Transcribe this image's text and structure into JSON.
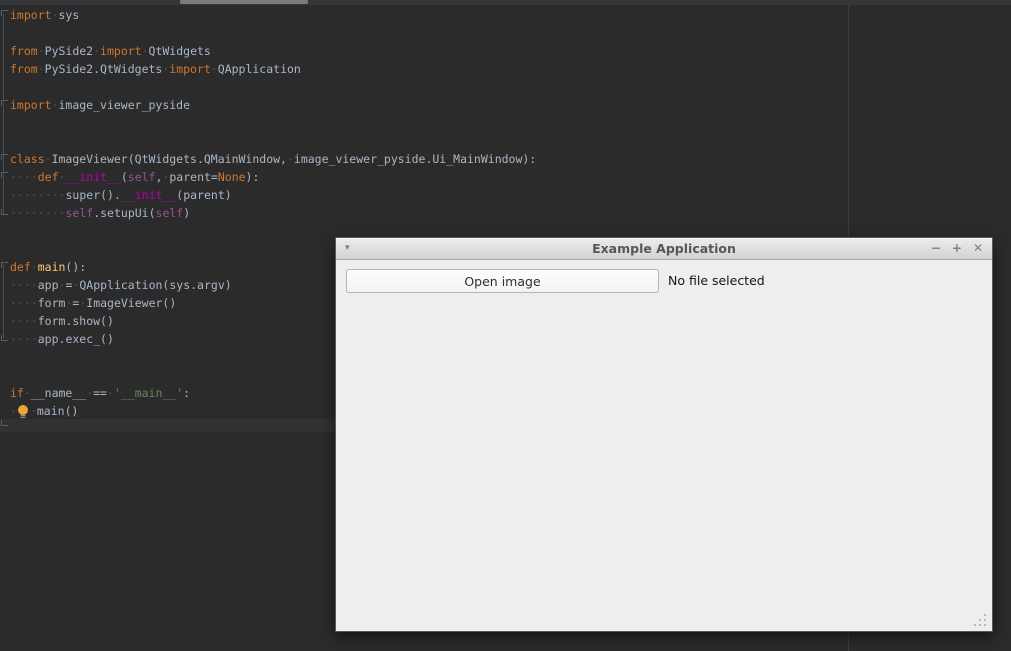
{
  "editor": {
    "background": "#2B2B2B",
    "syntax_colors": {
      "kw": "#CC7832",
      "pl": "#A9B7C6",
      "st": "#6A8759",
      "mg": "#B200B2",
      "sf": "#94558D",
      "fn": "#FFC66D"
    },
    "lines": [
      {
        "segments": [
          {
            "t": "import",
            "c": "kw"
          },
          {
            "t": " sys",
            "c": "pl"
          }
        ]
      },
      {
        "segments": []
      },
      {
        "segments": [
          {
            "t": "from",
            "c": "kw"
          },
          {
            "t": " PySide2 ",
            "c": "pl"
          },
          {
            "t": "import",
            "c": "kw"
          },
          {
            "t": " QtWidgets",
            "c": "pl"
          }
        ]
      },
      {
        "segments": [
          {
            "t": "from",
            "c": "kw"
          },
          {
            "t": " PySide2.QtWidgets ",
            "c": "pl"
          },
          {
            "t": "import",
            "c": "kw"
          },
          {
            "t": " QApplication",
            "c": "pl"
          }
        ]
      },
      {
        "segments": []
      },
      {
        "segments": [
          {
            "t": "import",
            "c": "kw"
          },
          {
            "t": " image_viewer_pyside",
            "c": "pl"
          }
        ]
      },
      {
        "segments": []
      },
      {
        "segments": []
      },
      {
        "segments": [
          {
            "t": "class",
            "c": "kw"
          },
          {
            "t": " ImageViewer(QtWidgets.QMainWindow, image_viewer_pyside.Ui_MainWindow):",
            "c": "pl"
          }
        ]
      },
      {
        "segments": [
          {
            "t": "    ",
            "c": "pl"
          },
          {
            "t": "def",
            "c": "kw"
          },
          {
            "t": " ",
            "c": "pl"
          },
          {
            "t": "__init__",
            "c": "mg"
          },
          {
            "t": "(",
            "c": "pl"
          },
          {
            "t": "self",
            "c": "sf"
          },
          {
            "t": ", parent=",
            "c": "pl"
          },
          {
            "t": "None",
            "c": "kw"
          },
          {
            "t": "):",
            "c": "pl"
          }
        ]
      },
      {
        "segments": [
          {
            "t": "        super().",
            "c": "pl"
          },
          {
            "t": "__init__",
            "c": "mg"
          },
          {
            "t": "(parent)",
            "c": "pl"
          }
        ]
      },
      {
        "segments": [
          {
            "t": "        ",
            "c": "pl"
          },
          {
            "t": "self",
            "c": "sf"
          },
          {
            "t": ".setupUi(",
            "c": "pl"
          },
          {
            "t": "self",
            "c": "sf"
          },
          {
            "t": ")",
            "c": "pl"
          }
        ]
      },
      {
        "segments": []
      },
      {
        "segments": []
      },
      {
        "segments": [
          {
            "t": "def",
            "c": "kw"
          },
          {
            "t": " ",
            "c": "pl"
          },
          {
            "t": "main",
            "c": "fn"
          },
          {
            "t": "():",
            "c": "pl"
          }
        ]
      },
      {
        "segments": [
          {
            "t": "    app = QApplication(sys.argv)",
            "c": "pl"
          }
        ]
      },
      {
        "segments": [
          {
            "t": "    form = ImageViewer()",
            "c": "pl"
          }
        ]
      },
      {
        "segments": [
          {
            "t": "    form.show()",
            "c": "pl"
          }
        ]
      },
      {
        "segments": [
          {
            "t": "    app.exec_()",
            "c": "pl"
          }
        ]
      },
      {
        "segments": []
      },
      {
        "segments": []
      },
      {
        "segments": [
          {
            "t": "if",
            "c": "kw"
          },
          {
            "t": " __name__ == ",
            "c": "pl"
          },
          {
            "t": "'__main__'",
            "c": "st"
          },
          {
            "t": ":",
            "c": "pl"
          }
        ]
      },
      {
        "segments": [
          {
            "t": " ",
            "c": "pl"
          },
          {
            "icon": "lightbulb-icon"
          },
          {
            "t": " main()",
            "c": "pl"
          }
        ]
      }
    ]
  },
  "app_window": {
    "title": "Example Application",
    "controls": {
      "menu": "▾",
      "minimize": "−",
      "maximize": "+",
      "close": "✕"
    },
    "open_button_label": "Open image",
    "status_label": "No file selected"
  }
}
